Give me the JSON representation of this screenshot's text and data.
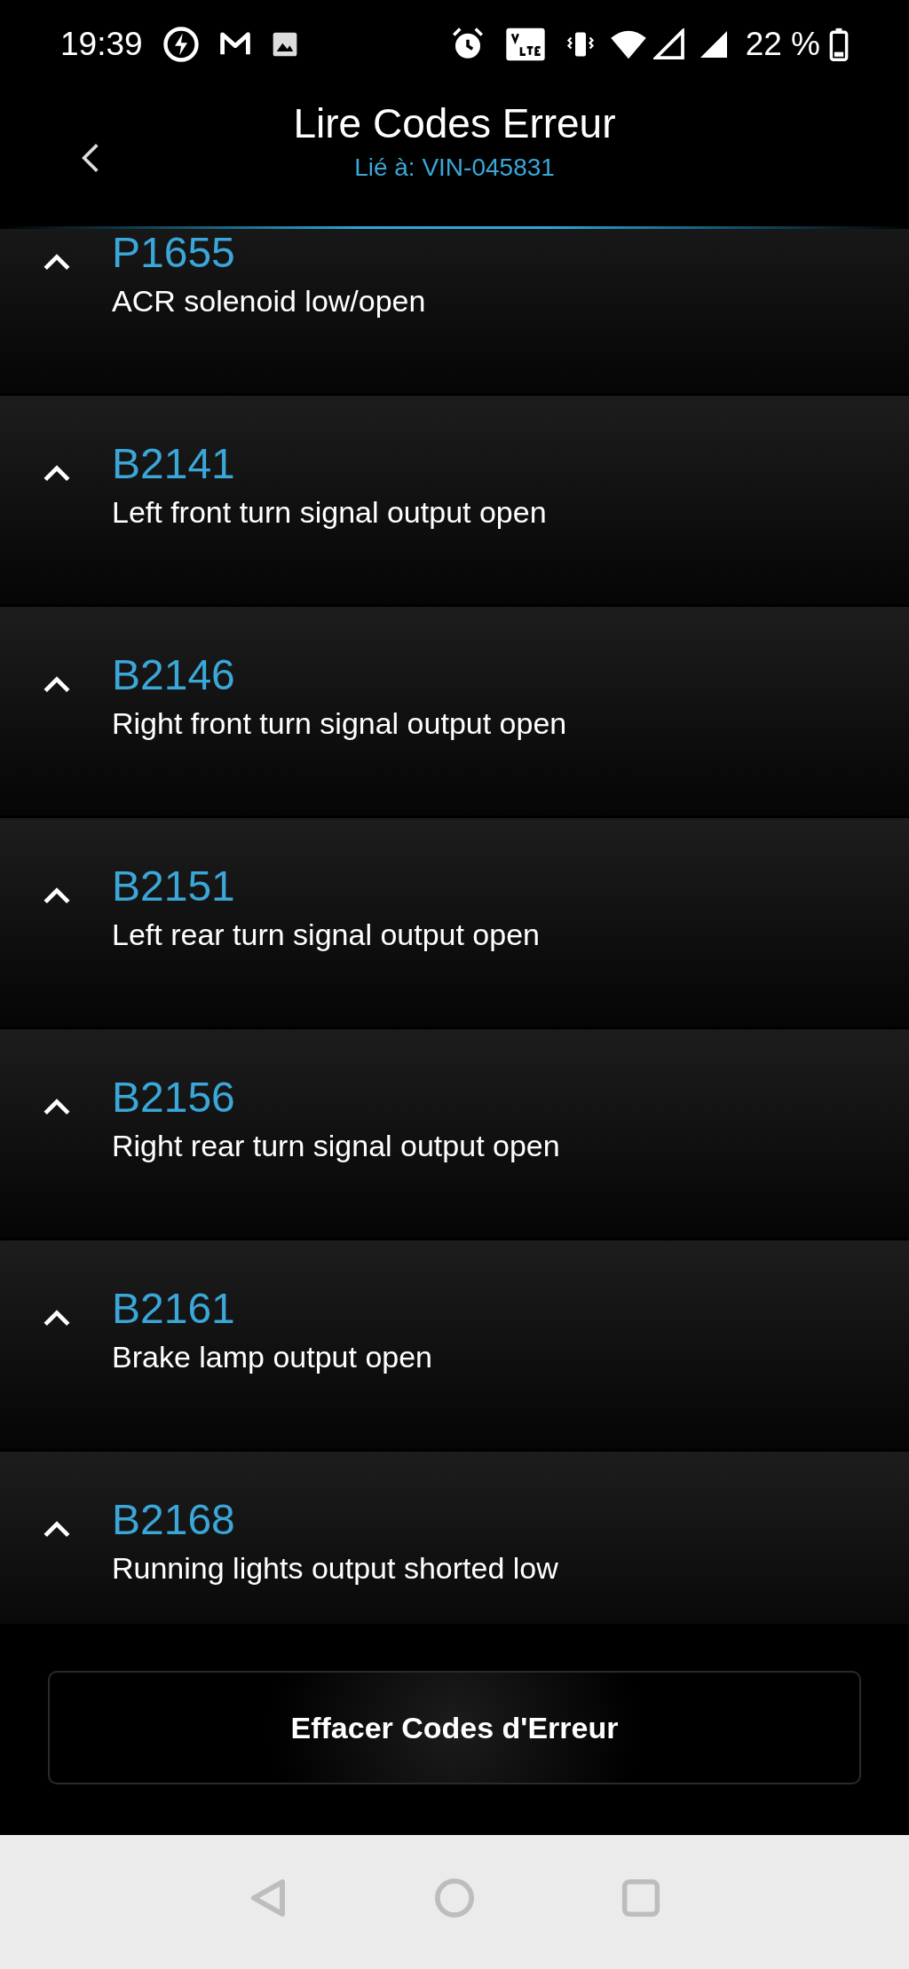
{
  "status_bar": {
    "time": "19:39",
    "battery": "22 %"
  },
  "header": {
    "title": "Lire Codes Erreur",
    "subtitle": "Lié à: VIN-045831"
  },
  "codes": [
    {
      "code": "P1655",
      "description": "ACR solenoid low/open",
      "expanded": true
    },
    {
      "code": "B2141",
      "description": "Left front turn signal output open",
      "expanded": true
    },
    {
      "code": "B2146",
      "description": "Right front turn signal output open",
      "expanded": true
    },
    {
      "code": "B2151",
      "description": "Left rear turn signal output open",
      "expanded": true
    },
    {
      "code": "B2156",
      "description": "Right rear turn signal output open",
      "expanded": true
    },
    {
      "code": "B2161",
      "description": "Brake lamp output open",
      "expanded": true
    },
    {
      "code": "B2168",
      "description": "Running lights output shorted low",
      "expanded": true
    }
  ],
  "clear_button": "Effacer Codes d'Erreur"
}
